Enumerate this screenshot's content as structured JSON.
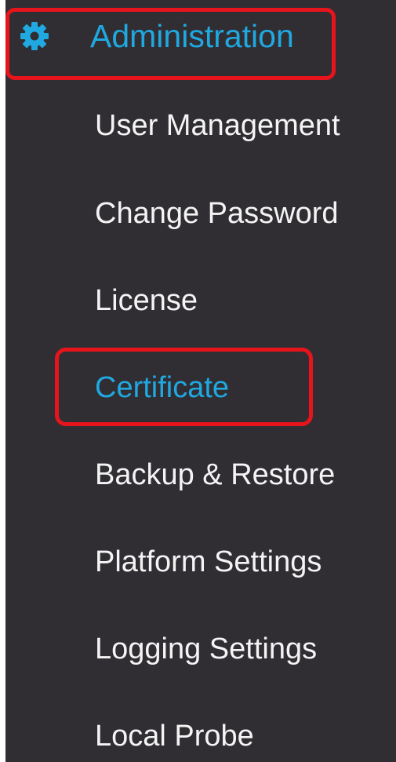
{
  "menu": {
    "header": {
      "label": "Administration",
      "icon": "gear-icon",
      "color": "#20a8e0"
    },
    "items": [
      {
        "label": "User Management",
        "active": false
      },
      {
        "label": "Change Password",
        "active": false
      },
      {
        "label": "License",
        "active": false
      },
      {
        "label": "Certificate",
        "active": true
      },
      {
        "label": "Backup & Restore",
        "active": false
      },
      {
        "label": "Platform Settings",
        "active": false
      },
      {
        "label": "Logging Settings",
        "active": false
      },
      {
        "label": "Local Probe",
        "active": false
      }
    ]
  },
  "colors": {
    "background": "#302e33",
    "text": "#f4f4f4",
    "accent": "#20a8e0",
    "highlight": "#e8141c"
  }
}
